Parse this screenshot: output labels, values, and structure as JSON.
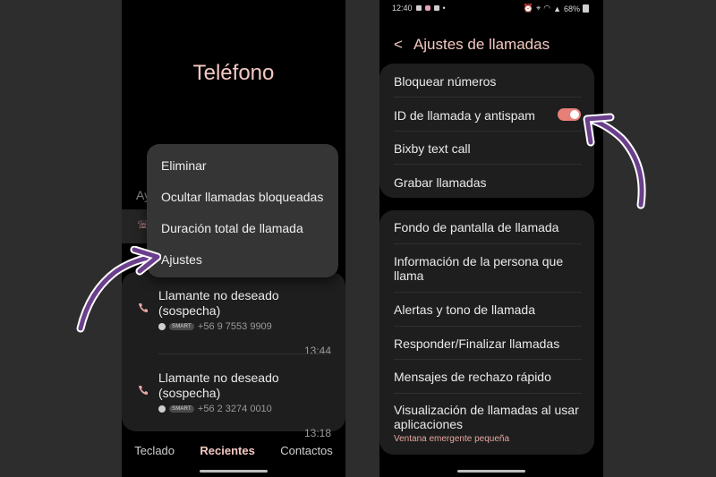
{
  "left_phone": {
    "app_title": "Teléfono",
    "partial_label": "Ay",
    "context_menu": {
      "items": [
        "Eliminar",
        "Ocultar llamadas bloqueadas",
        "Duración total de llamada",
        "Ajustes"
      ]
    },
    "calls": [
      {
        "name": "Llamante no deseado (sospecha)",
        "badge": "SMART",
        "number": "+56 9 7553 9909",
        "time": "13:44"
      },
      {
        "name": "Llamante no deseado (sospecha)",
        "badge": "SMART",
        "number": "+56 2 3274 0010",
        "time": "13:18"
      }
    ],
    "bottom_nav": {
      "keypad": "Teclado",
      "recents": "Recientes",
      "contacts": "Contactos"
    }
  },
  "right_phone": {
    "status": {
      "time": "12:40",
      "battery": "68%"
    },
    "header": {
      "title": "Ajustes de llamadas"
    },
    "group1": {
      "block_numbers": "Bloquear números",
      "caller_id": "ID de llamada y antispam",
      "caller_id_enabled": true,
      "bixby": "Bixby text call",
      "record": "Grabar llamadas"
    },
    "group2": {
      "wallpaper": "Fondo de pantalla de llamada",
      "caller_info": "Información de la persona que llama",
      "alerts": "Alertas y tono de llamada",
      "answer_end": "Responder/Finalizar llamadas",
      "reject_msgs": "Mensajes de rechazo rápido",
      "display_using_apps": "Visualización de llamadas al usar aplicaciones",
      "display_using_apps_sub": "Ventana emergente pequeña"
    }
  },
  "colors": {
    "accent": "#f3c8c2",
    "toggle_on": "#e57f78",
    "arrow": "#6b3f8c"
  }
}
